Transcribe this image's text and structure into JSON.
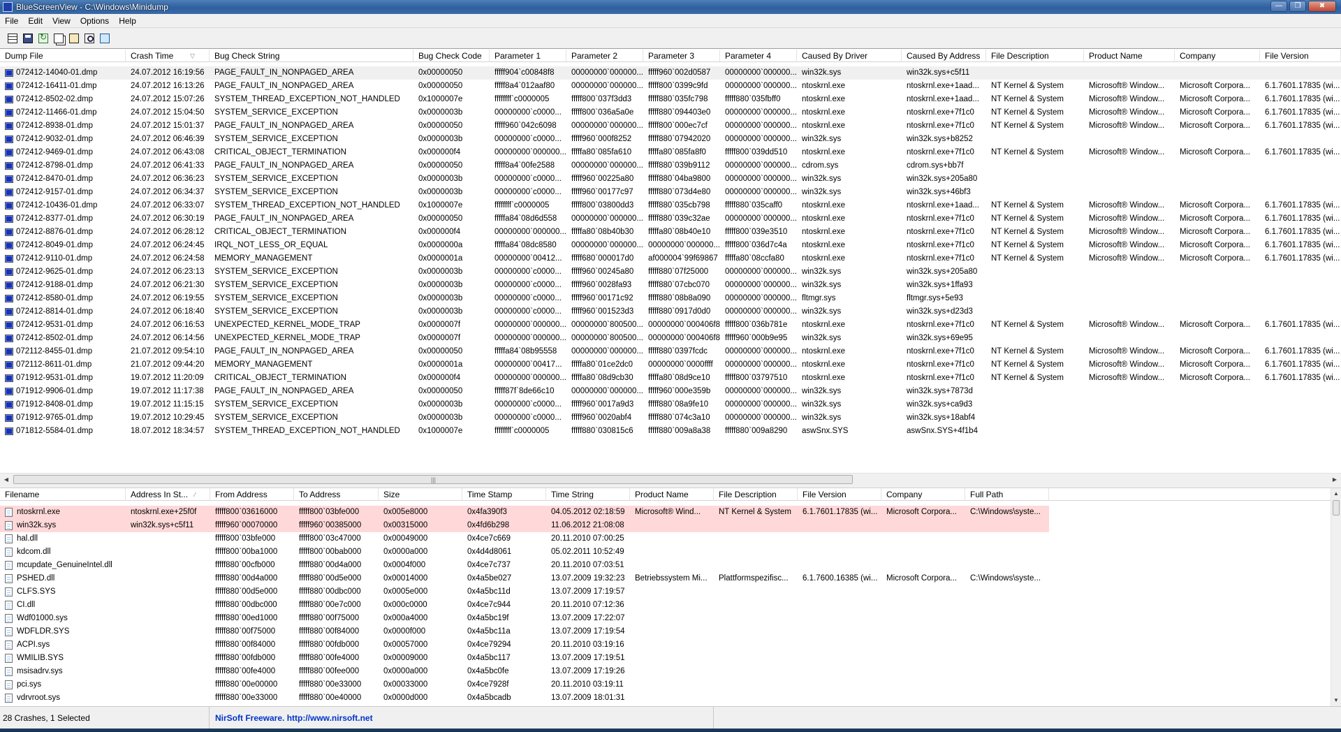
{
  "window": {
    "title": "BlueScreenView  -  C:\\Windows\\Minidump",
    "min_glyph": "—",
    "max_glyph": "❒",
    "close_glyph": "✖"
  },
  "menu": [
    "File",
    "Edit",
    "View",
    "Options",
    "Help"
  ],
  "toolbar": [
    "properties-icon",
    "save-icon",
    "refresh-icon",
    "copy-icon",
    "html-report-icon",
    "find-icon",
    "exit-icon"
  ],
  "crashes": {
    "columns": [
      "Dump File",
      "Crash Time",
      "Bug Check String",
      "Bug Check Code",
      "Parameter 1",
      "Parameter 2",
      "Parameter 3",
      "Parameter 4",
      "Caused By Driver",
      "Caused By Address",
      "File Description",
      "Product Name",
      "Company",
      "File Version"
    ],
    "sort_indicator": "▽",
    "rows": [
      [
        "072412-14040-01.dmp",
        "24.07.2012 16:19:56",
        "PAGE_FAULT_IN_NONPAGED_AREA",
        "0x00000050",
        "fffff904`c00848f8",
        "00000000`000000...",
        "fffff960`002d0587",
        "00000000`000000...",
        "win32k.sys",
        "win32k.sys+c5f11",
        "",
        "",
        "",
        ""
      ],
      [
        "072412-16411-01.dmp",
        "24.07.2012 16:13:26",
        "PAGE_FAULT_IN_NONPAGED_AREA",
        "0x00000050",
        "fffff8a4`012aaf80",
        "00000000`000000...",
        "fffff800`0399c9fd",
        "00000000`000000...",
        "ntoskrnl.exe",
        "ntoskrnl.exe+1aad...",
        "NT Kernel & System",
        "Microsoft® Window...",
        "Microsoft Corpora...",
        "6.1.7601.17835 (wi..."
      ],
      [
        "072412-8502-02.dmp",
        "24.07.2012 15:07:26",
        "SYSTEM_THREAD_EXCEPTION_NOT_HANDLED",
        "0x1000007e",
        "ffffffff`c0000005",
        "fffff800`037f3dd3",
        "fffff880`035fc798",
        "fffff880`035fbff0",
        "ntoskrnl.exe",
        "ntoskrnl.exe+1aad...",
        "NT Kernel & System",
        "Microsoft® Window...",
        "Microsoft Corpora...",
        "6.1.7601.17835 (wi..."
      ],
      [
        "072412-11466-01.dmp",
        "24.07.2012 15:04:50",
        "SYSTEM_SERVICE_EXCEPTION",
        "0x0000003b",
        "00000000`c0000...",
        "fffff800`036a5a0e",
        "fffff880`094403e0",
        "00000000`000000...",
        "ntoskrnl.exe",
        "ntoskrnl.exe+7f1c0",
        "NT Kernel & System",
        "Microsoft® Window...",
        "Microsoft Corpora...",
        "6.1.7601.17835 (wi..."
      ],
      [
        "072412-8938-01.dmp",
        "24.07.2012 15:01:37",
        "PAGE_FAULT_IN_NONPAGED_AREA",
        "0x00000050",
        "fffff960`042c6098",
        "00000000`000000...",
        "fffff800`000ec7cf",
        "00000000`000000...",
        "ntoskrnl.exe",
        "ntoskrnl.exe+7f1c0",
        "NT Kernel & System",
        "Microsoft® Window...",
        "Microsoft Corpora...",
        "6.1.7601.17835 (wi..."
      ],
      [
        "072412-9032-01.dmp",
        "24.07.2012 06:46:39",
        "SYSTEM_SERVICE_EXCEPTION",
        "0x0000003b",
        "00000000`c0000...",
        "fffff960`000f8252",
        "fffff880`07942020",
        "00000000`000000...",
        "win32k.sys",
        "win32k.sys+b8252",
        "",
        "",
        "",
        ""
      ],
      [
        "072412-9469-01.dmp",
        "24.07.2012 06:43:08",
        "CRITICAL_OBJECT_TERMINATION",
        "0x000000f4",
        "00000000`000000...",
        "fffffa80`085fa610",
        "fffffa80`085fa8f0",
        "fffff800`039dd510",
        "ntoskrnl.exe",
        "ntoskrnl.exe+7f1c0",
        "NT Kernel & System",
        "Microsoft® Window...",
        "Microsoft Corpora...",
        "6.1.7601.17835 (wi..."
      ],
      [
        "072412-8798-01.dmp",
        "24.07.2012 06:41:33",
        "PAGE_FAULT_IN_NONPAGED_AREA",
        "0x00000050",
        "fffff8a4`00fe2588",
        "00000000`000000...",
        "fffff880`039b9112",
        "00000000`000000...",
        "cdrom.sys",
        "cdrom.sys+bb7f",
        "",
        "",
        "",
        ""
      ],
      [
        "072412-8470-01.dmp",
        "24.07.2012 06:36:23",
        "SYSTEM_SERVICE_EXCEPTION",
        "0x0000003b",
        "00000000`c0000...",
        "fffff960`00225a80",
        "fffff880`04ba9800",
        "00000000`000000...",
        "win32k.sys",
        "win32k.sys+205a80",
        "",
        "",
        "",
        ""
      ],
      [
        "072412-9157-01.dmp",
        "24.07.2012 06:34:37",
        "SYSTEM_SERVICE_EXCEPTION",
        "0x0000003b",
        "00000000`c0000...",
        "fffff960`00177c97",
        "fffff880`073d4e80",
        "00000000`000000...",
        "win32k.sys",
        "win32k.sys+46bf3",
        "",
        "",
        "",
        ""
      ],
      [
        "072412-10436-01.dmp",
        "24.07.2012 06:33:07",
        "SYSTEM_THREAD_EXCEPTION_NOT_HANDLED",
        "0x1000007e",
        "ffffffff`c0000005",
        "fffff800`03800dd3",
        "fffff880`035cb798",
        "fffff880`035caff0",
        "ntoskrnl.exe",
        "ntoskrnl.exe+1aad...",
        "NT Kernel & System",
        "Microsoft® Window...",
        "Microsoft Corpora...",
        "6.1.7601.17835 (wi..."
      ],
      [
        "072412-8377-01.dmp",
        "24.07.2012 06:30:19",
        "PAGE_FAULT_IN_NONPAGED_AREA",
        "0x00000050",
        "fffffa84`08d6d558",
        "00000000`000000...",
        "fffff880`039c32ae",
        "00000000`000000...",
        "ntoskrnl.exe",
        "ntoskrnl.exe+7f1c0",
        "NT Kernel & System",
        "Microsoft® Window...",
        "Microsoft Corpora...",
        "6.1.7601.17835 (wi..."
      ],
      [
        "072412-8876-01.dmp",
        "24.07.2012 06:28:12",
        "CRITICAL_OBJECT_TERMINATION",
        "0x000000f4",
        "00000000`000000...",
        "fffffa80`08b40b30",
        "fffffa80`08b40e10",
        "fffff800`039e3510",
        "ntoskrnl.exe",
        "ntoskrnl.exe+7f1c0",
        "NT Kernel & System",
        "Microsoft® Window...",
        "Microsoft Corpora...",
        "6.1.7601.17835 (wi..."
      ],
      [
        "072412-8049-01.dmp",
        "24.07.2012 06:24:45",
        "IRQL_NOT_LESS_OR_EQUAL",
        "0x0000000a",
        "fffffa84`08dc8580",
        "00000000`000000...",
        "00000000`000000...",
        "fffff800`036d7c4a",
        "ntoskrnl.exe",
        "ntoskrnl.exe+7f1c0",
        "NT Kernel & System",
        "Microsoft® Window...",
        "Microsoft Corpora...",
        "6.1.7601.17835 (wi..."
      ],
      [
        "072412-9110-01.dmp",
        "24.07.2012 06:24:58",
        "MEMORY_MANAGEMENT",
        "0x0000001a",
        "00000000`00412...",
        "fffff680`000017d0",
        "af000004`99f69867",
        "fffffa80`08ccfa80",
        "ntoskrnl.exe",
        "ntoskrnl.exe+7f1c0",
        "NT Kernel & System",
        "Microsoft® Window...",
        "Microsoft Corpora...",
        "6.1.7601.17835 (wi..."
      ],
      [
        "072412-9625-01.dmp",
        "24.07.2012 06:23:13",
        "SYSTEM_SERVICE_EXCEPTION",
        "0x0000003b",
        "00000000`c0000...",
        "fffff960`00245a80",
        "fffff880`07f25000",
        "00000000`000000...",
        "win32k.sys",
        "win32k.sys+205a80",
        "",
        "",
        "",
        ""
      ],
      [
        "072412-9188-01.dmp",
        "24.07.2012 06:21:30",
        "SYSTEM_SERVICE_EXCEPTION",
        "0x0000003b",
        "00000000`c0000...",
        "fffff960`0028fa93",
        "fffff880`07cbc070",
        "00000000`000000...",
        "win32k.sys",
        "win32k.sys+1ffa93",
        "",
        "",
        "",
        ""
      ],
      [
        "072412-8580-01.dmp",
        "24.07.2012 06:19:55",
        "SYSTEM_SERVICE_EXCEPTION",
        "0x0000003b",
        "00000000`c0000...",
        "fffff960`00171c92",
        "fffff880`08b8a090",
        "00000000`000000...",
        "fltmgr.sys",
        "fltmgr.sys+5e93",
        "",
        "",
        "",
        ""
      ],
      [
        "072412-8814-01.dmp",
        "24.07.2012 06:18:40",
        "SYSTEM_SERVICE_EXCEPTION",
        "0x0000003b",
        "00000000`c0000...",
        "fffff960`001523d3",
        "fffff880`0917d0d0",
        "00000000`000000...",
        "win32k.sys",
        "win32k.sys+d23d3",
        "",
        "",
        "",
        ""
      ],
      [
        "072412-9531-01.dmp",
        "24.07.2012 06:16:53",
        "UNEXPECTED_KERNEL_MODE_TRAP",
        "0x0000007f",
        "00000000`000000...",
        "00000000`800500...",
        "00000000`000406f8",
        "fffff800`036b781e",
        "ntoskrnl.exe",
        "ntoskrnl.exe+7f1c0",
        "NT Kernel & System",
        "Microsoft® Window...",
        "Microsoft Corpora...",
        "6.1.7601.17835 (wi..."
      ],
      [
        "072412-8502-01.dmp",
        "24.07.2012 06:14:56",
        "UNEXPECTED_KERNEL_MODE_TRAP",
        "0x0000007f",
        "00000000`000000...",
        "00000000`800500...",
        "00000000`000406f8",
        "fffff960`000b9e95",
        "win32k.sys",
        "win32k.sys+69e95",
        "",
        "",
        "",
        ""
      ],
      [
        "072112-8455-01.dmp",
        "21.07.2012 09:54:10",
        "PAGE_FAULT_IN_NONPAGED_AREA",
        "0x00000050",
        "fffffa84`08b95558",
        "00000000`000000...",
        "fffff880`0397fcdc",
        "00000000`000000...",
        "ntoskrnl.exe",
        "ntoskrnl.exe+7f1c0",
        "NT Kernel & System",
        "Microsoft® Window...",
        "Microsoft Corpora...",
        "6.1.7601.17835 (wi..."
      ],
      [
        "072112-8611-01.dmp",
        "21.07.2012 09:44:20",
        "MEMORY_MANAGEMENT",
        "0x0000001a",
        "00000000`00417...",
        "fffffa80`01ce2dc0",
        "00000000`0000ffff",
        "00000000`000000...",
        "ntoskrnl.exe",
        "ntoskrnl.exe+7f1c0",
        "NT Kernel & System",
        "Microsoft® Window...",
        "Microsoft Corpora...",
        "6.1.7601.17835 (wi..."
      ],
      [
        "071912-9531-01.dmp",
        "19.07.2012 11:20:09",
        "CRITICAL_OBJECT_TERMINATION",
        "0x000000f4",
        "00000000`000000...",
        "fffffa80`08d9cb30",
        "fffffa80`08d9ce10",
        "fffff800`03797510",
        "ntoskrnl.exe",
        "ntoskrnl.exe+7f1c0",
        "NT Kernel & System",
        "Microsoft® Window...",
        "Microsoft Corpora...",
        "6.1.7601.17835 (wi..."
      ],
      [
        "071912-9906-01.dmp",
        "19.07.2012 11:17:38",
        "PAGE_FAULT_IN_NONPAGED_AREA",
        "0x00000050",
        "fffff87f`8de66c10",
        "00000000`000000...",
        "fffff960`000e359b",
        "00000000`000000...",
        "win32k.sys",
        "win32k.sys+7873d",
        "",
        "",
        "",
        ""
      ],
      [
        "071912-8408-01.dmp",
        "19.07.2012 11:15:15",
        "SYSTEM_SERVICE_EXCEPTION",
        "0x0000003b",
        "00000000`c0000...",
        "fffff960`0017a9d3",
        "fffff880`08a9fe10",
        "00000000`000000...",
        "win32k.sys",
        "win32k.sys+ca9d3",
        "",
        "",
        "",
        ""
      ],
      [
        "071912-9765-01.dmp",
        "19.07.2012 10:29:45",
        "SYSTEM_SERVICE_EXCEPTION",
        "0x0000003b",
        "00000000`c0000...",
        "fffff960`0020abf4",
        "fffff880`074c3a10",
        "00000000`000000...",
        "win32k.sys",
        "win32k.sys+18abf4",
        "",
        "",
        "",
        ""
      ],
      [
        "071812-5584-01.dmp",
        "18.07.2012 18:34:57",
        "SYSTEM_THREAD_EXCEPTION_NOT_HANDLED",
        "0x1000007e",
        "ffffffff`c0000005",
        "fffff880`030815c6",
        "fffff880`009a8a38",
        "fffff880`009a8290",
        "aswSnx.SYS",
        "aswSnx.SYS+4f1b4",
        "",
        "",
        "",
        ""
      ]
    ]
  },
  "drivers": {
    "columns": [
      "Filename",
      "Address In St...",
      "From Address",
      "To Address",
      "Size",
      "Time Stamp",
      "Time String",
      "Product Name",
      "File Description",
      "File Version",
      "Company",
      "Full Path"
    ],
    "sort_indicator": "∕",
    "rows": [
      [
        "ntoskrnl.exe",
        "ntoskrnl.exe+25f0f",
        "fffff800`03616000",
        "fffff800`03bfe000",
        "0x005e8000",
        "0x4fa390f3",
        "04.05.2012 02:18:59",
        "Microsoft® Wind...",
        "NT Kernel & System",
        "6.1.7601.17835 (wi...",
        "Microsoft Corpora...",
        "C:\\Windows\\syste..."
      ],
      [
        "win32k.sys",
        "win32k.sys+c5f11",
        "fffff960`00070000",
        "fffff960`00385000",
        "0x00315000",
        "0x4fd6b298",
        "11.06.2012 21:08:08",
        "",
        "",
        "",
        "",
        ""
      ],
      [
        "hal.dll",
        "",
        "fffff800`03bfe000",
        "fffff800`03c47000",
        "0x00049000",
        "0x4ce7c669",
        "20.11.2010 07:00:25",
        "",
        "",
        "",
        "",
        ""
      ],
      [
        "kdcom.dll",
        "",
        "fffff800`00ba1000",
        "fffff800`00bab000",
        "0x0000a000",
        "0x4d4d8061",
        "05.02.2011 10:52:49",
        "",
        "",
        "",
        "",
        ""
      ],
      [
        "mcupdate_GenuineIntel.dll",
        "",
        "fffff880`00cfb000",
        "fffff880`00d4a000",
        "0x0004f000",
        "0x4ce7c737",
        "20.11.2010 07:03:51",
        "",
        "",
        "",
        "",
        ""
      ],
      [
        "PSHED.dll",
        "",
        "fffff880`00d4a000",
        "fffff880`00d5e000",
        "0x00014000",
        "0x4a5be027",
        "13.07.2009 19:32:23",
        "Betriebssystem Mi...",
        "Plattformspezifisc...",
        "6.1.7600.16385 (wi...",
        "Microsoft Corpora...",
        "C:\\Windows\\syste..."
      ],
      [
        "CLFS.SYS",
        "",
        "fffff880`00d5e000",
        "fffff880`00dbc000",
        "0x0005e000",
        "0x4a5bc11d",
        "13.07.2009 17:19:57",
        "",
        "",
        "",
        "",
        ""
      ],
      [
        "CI.dll",
        "",
        "fffff880`00dbc000",
        "fffff880`00e7c000",
        "0x000c0000",
        "0x4ce7c944",
        "20.11.2010 07:12:36",
        "",
        "",
        "",
        "",
        ""
      ],
      [
        "Wdf01000.sys",
        "",
        "fffff880`00ed1000",
        "fffff880`00f75000",
        "0x000a4000",
        "0x4a5bc19f",
        "13.07.2009 17:22:07",
        "",
        "",
        "",
        "",
        ""
      ],
      [
        "WDFLDR.SYS",
        "",
        "fffff880`00f75000",
        "fffff880`00f84000",
        "0x0000f000",
        "0x4a5bc11a",
        "13.07.2009 17:19:54",
        "",
        "",
        "",
        "",
        ""
      ],
      [
        "ACPI.sys",
        "",
        "fffff880`00f84000",
        "fffff880`00fdb000",
        "0x00057000",
        "0x4ce79294",
        "20.11.2010 03:19:16",
        "",
        "",
        "",
        "",
        ""
      ],
      [
        "WMILIB.SYS",
        "",
        "fffff880`00fdb000",
        "fffff880`00fe4000",
        "0x00009000",
        "0x4a5bc117",
        "13.07.2009 17:19:51",
        "",
        "",
        "",
        "",
        ""
      ],
      [
        "msisadrv.sys",
        "",
        "fffff880`00fe4000",
        "fffff880`00fee000",
        "0x0000a000",
        "0x4a5bc0fe",
        "13.07.2009 17:19:26",
        "",
        "",
        "",
        "",
        ""
      ],
      [
        "pci.sys",
        "",
        "fffff880`00e00000",
        "fffff880`00e33000",
        "0x00033000",
        "0x4ce7928f",
        "20.11.2010 03:19:11",
        "",
        "",
        "",
        "",
        ""
      ],
      [
        "vdrvroot.sys",
        "",
        "fffff880`00e33000",
        "fffff880`00e40000",
        "0x0000d000",
        "0x4a5bcadb",
        "13.07.2009 18:01:31",
        "",
        "",
        "",
        "",
        ""
      ]
    ]
  },
  "scroll": {
    "left": "◀",
    "right": "▶",
    "up": "▲",
    "down": "▼",
    "grip": "|||"
  },
  "status": {
    "count": "28 Crashes, 1 Selected",
    "credit": "NirSoft Freeware.  http://www.nirsoft.net"
  },
  "colors": {
    "selected_row": "#f0f0f0",
    "highlight_row": "#ffd9d9",
    "dump_icon": "#1733b0"
  }
}
